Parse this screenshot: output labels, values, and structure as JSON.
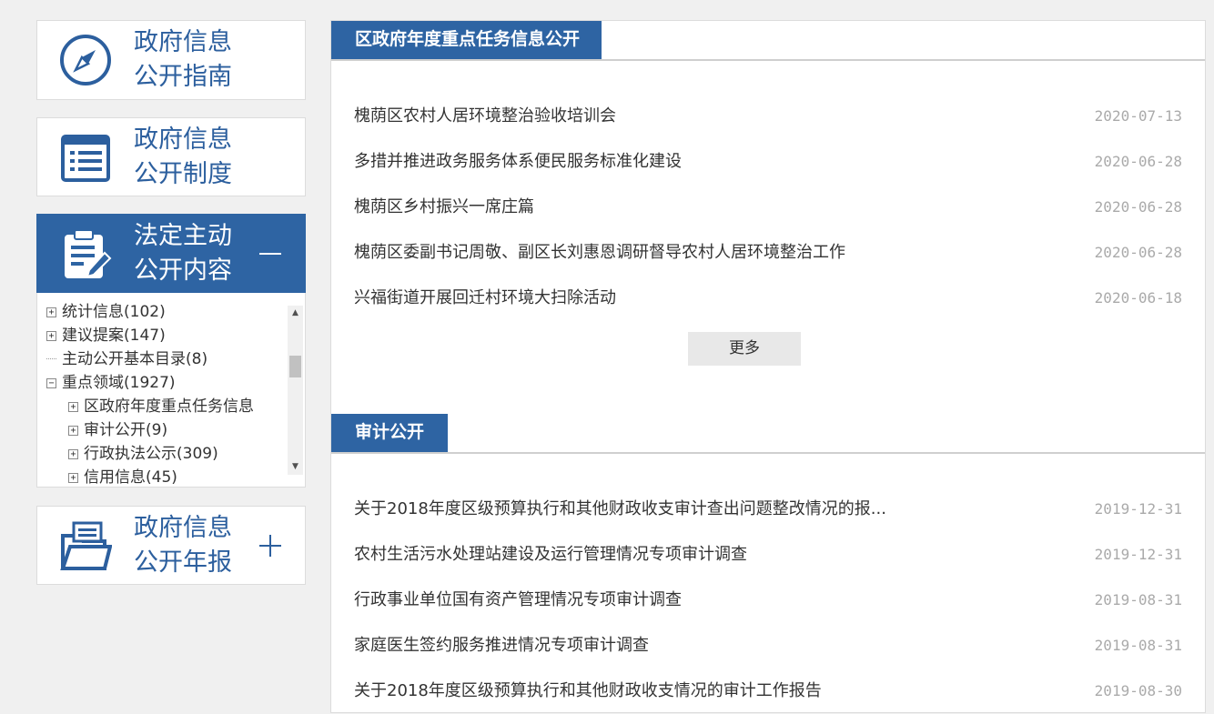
{
  "sidebar": {
    "cards": [
      {
        "line1": "政府信息",
        "line2": "公开指南",
        "icon": "compass-icon"
      },
      {
        "line1": "政府信息",
        "line2": "公开制度",
        "icon": "list-document-icon"
      },
      {
        "line1": "法定主动",
        "line2": "公开内容",
        "icon": "clipboard-edit-icon",
        "toggle": "minus-icon"
      },
      {
        "line1": "政府信息",
        "line2": "公开年报",
        "icon": "folder-document-icon",
        "toggle": "plus-icon"
      }
    ],
    "tree": [
      {
        "label": "统计信息(102)",
        "expander": "+"
      },
      {
        "label": "建议提案(147)",
        "expander": "+"
      },
      {
        "label": "主动公开基本目录(8)",
        "expander": ""
      },
      {
        "label": "重点领域(1927)",
        "expander": "−"
      },
      {
        "label": "区政府年度重点任务信息",
        "expander": "+"
      },
      {
        "label": "审计公开(9)",
        "expander": "+"
      },
      {
        "label": "行政执法公示(309)",
        "expander": "+"
      },
      {
        "label": "信用信息(45)",
        "expander": "+"
      }
    ]
  },
  "sections": [
    {
      "title": "区政府年度重点任务信息公开",
      "items": [
        {
          "title": "槐荫区农村人居环境整治验收培训会",
          "date": "2020-07-13"
        },
        {
          "title": "多措并推进政务服务体系便民服务标准化建设",
          "date": "2020-06-28"
        },
        {
          "title": "槐荫区乡村振兴一席庄篇",
          "date": "2020-06-28"
        },
        {
          "title": "槐荫区委副书记周敬、副区长刘惠恩调研督导农村人居环境整治工作",
          "date": "2020-06-28"
        },
        {
          "title": "兴福街道开展回迁村环境大扫除活动",
          "date": "2020-06-18"
        }
      ],
      "more_label": "更多"
    },
    {
      "title": "审计公开",
      "items": [
        {
          "title": "关于2018年度区级预算执行和其他财政收支审计查出问题整改情况的报...",
          "date": "2019-12-31"
        },
        {
          "title": "农村生活污水处理站建设及运行管理情况专项审计调查",
          "date": "2019-12-31"
        },
        {
          "title": "行政事业单位国有资产管理情况专项审计调查",
          "date": "2019-08-31"
        },
        {
          "title": "家庭医生签约服务推进情况专项审计调查",
          "date": "2019-08-31"
        },
        {
          "title": "关于2018年度区级预算执行和其他财政收支情况的审计工作报告",
          "date": "2019-08-30"
        }
      ]
    }
  ]
}
